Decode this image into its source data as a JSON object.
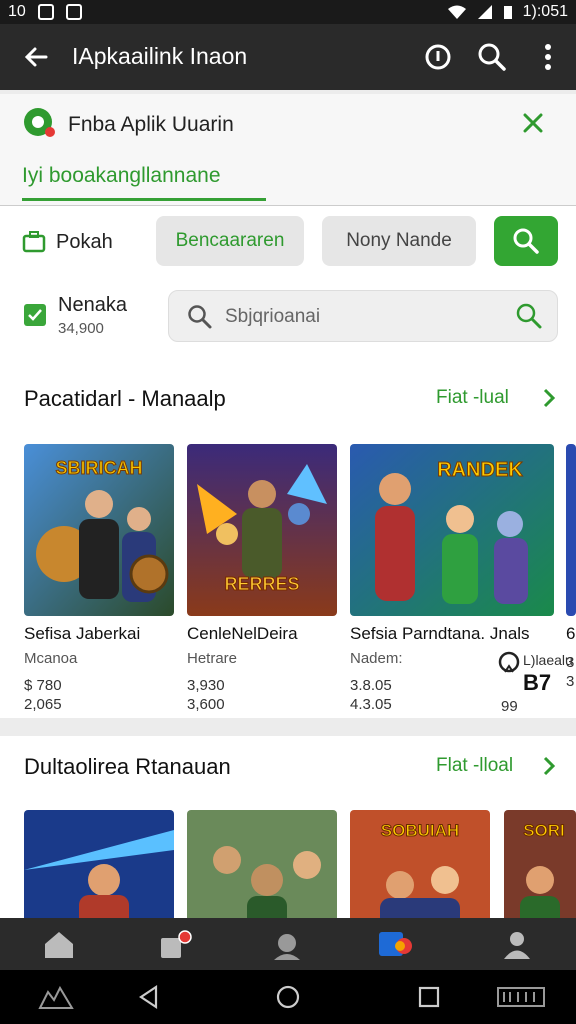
{
  "status_bar": {
    "left": [
      "10"
    ],
    "time": "1):051"
  },
  "app_bar": {
    "title": "IApkaailink Inaon"
  },
  "card": {
    "title": "Fnba Aplik Uuarin",
    "tab_label": "Iyi booakangllannane"
  },
  "filters": {
    "category_label": "Pokah",
    "chip1": "Bencaararen",
    "chip2": "Nony Nande",
    "checkbox_label": "Nenaka",
    "checkbox_sub": "34,900",
    "search_placeholder": "Sbjqrioanai"
  },
  "section1": {
    "title": "Pacatidarl - Manaalp",
    "see_more": "Fiat -lual",
    "items": [
      {
        "name": "Sefisa Jaberkai",
        "dev": "Mcanoa",
        "price": "$ 780",
        "count": "2,065",
        "art": "SBIRICAH"
      },
      {
        "name": "CenleNelDeira",
        "dev": "Hetrare",
        "price": "3,930",
        "count": "3,600",
        "art": "RERRES"
      },
      {
        "name": "Sefsia Parndtana. Jnals",
        "dev": "Nadem:",
        "price": "3.8.05",
        "count": "4.3.05",
        "art": "RANDEK"
      },
      {
        "name": "6",
        "dev": "",
        "price": "3",
        "count": "3",
        "art": ""
      }
    ],
    "overlay_text": "B7",
    "overlay_sub": "99",
    "overlay_mini": "L)laealu"
  },
  "section2": {
    "title": "Dultaolirea Rtanauan",
    "see_more": "Flat -lloal",
    "arts": [
      "",
      "",
      "SOBUIAH",
      "SORI"
    ]
  },
  "colors": {
    "accent": "#33a633",
    "appbar": "#2a2a2a"
  }
}
